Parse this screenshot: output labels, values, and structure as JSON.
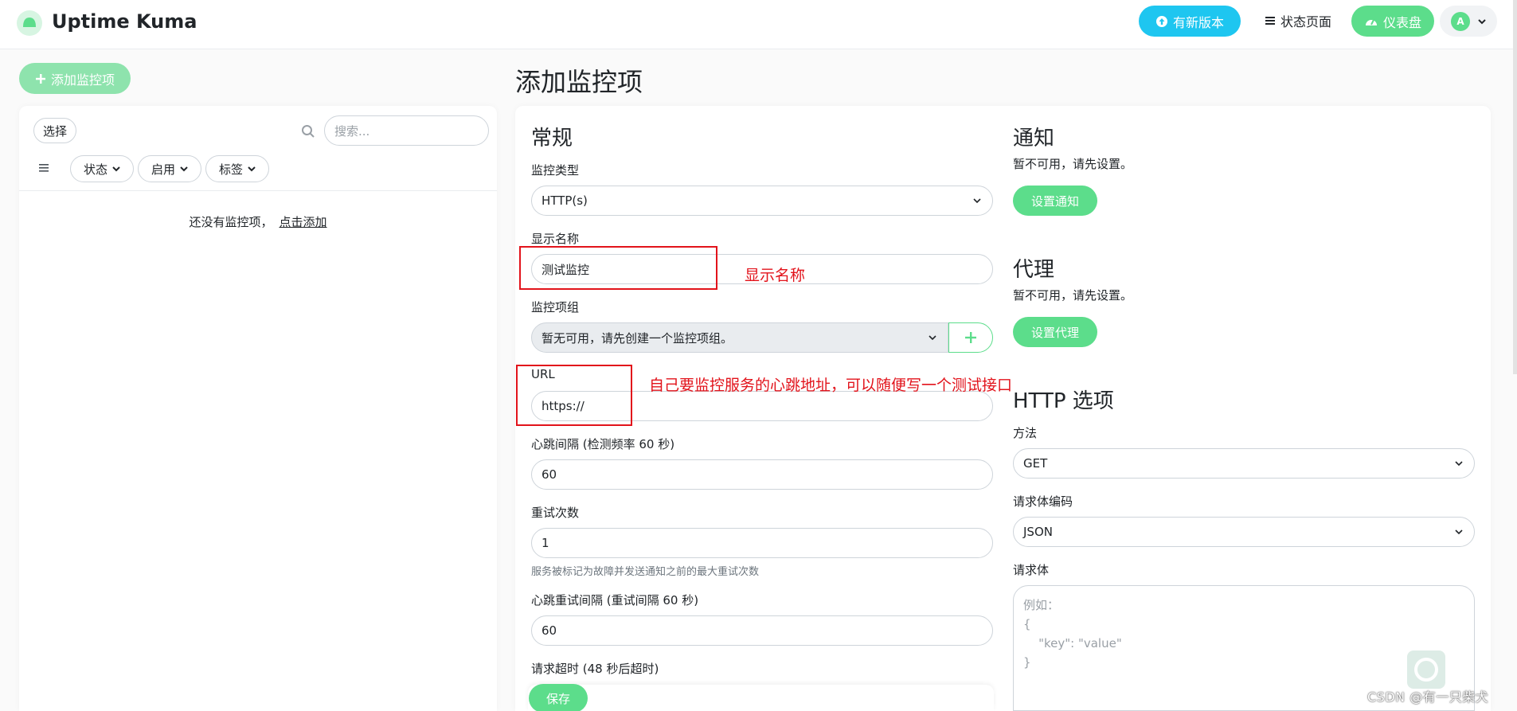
{
  "header": {
    "app_title": "Uptime Kuma",
    "update_label": "有新版本",
    "status_page_label": "状态页面",
    "dashboard_label": "仪表盘",
    "avatar_letter": "A"
  },
  "sidebar": {
    "add_button": "添加监控项",
    "select_button": "选择",
    "search_placeholder": "搜索...",
    "filters": [
      "状态",
      "启用",
      "标签"
    ],
    "empty_text": "还没有监控项，",
    "empty_link": "点击添加"
  },
  "main": {
    "page_title": "添加监控项",
    "general": {
      "title": "常规",
      "monitor_type_label": "监控类型",
      "monitor_type_value": "HTTP(s)",
      "display_name_label": "显示名称",
      "display_name_value": "测试监控",
      "group_label": "监控项组",
      "group_value": "暂无可用，请先创建一个监控项组。",
      "url_label": "URL",
      "url_value": "https://",
      "interval_label": "心跳间隔 (检测频率 60 秒)",
      "interval_value": "60",
      "retries_label": "重试次数",
      "retries_value": "1",
      "retries_help": "服务被标记为故障并发送通知之前的最大重试次数",
      "retry_interval_label": "心跳重试间隔 (重试间隔 60 秒)",
      "retry_interval_value": "60",
      "timeout_label": "请求超时 (48 秒后超时)"
    },
    "notifications": {
      "title": "通知",
      "text": "暂不可用，请先设置。",
      "button": "设置通知"
    },
    "proxy": {
      "title": "代理",
      "text": "暂不可用，请先设置。",
      "button": "设置代理"
    },
    "http_options": {
      "title": "HTTP 选项",
      "method_label": "方法",
      "method_value": "GET",
      "encoding_label": "请求体编码",
      "encoding_value": "JSON",
      "body_label": "请求体",
      "body_placeholder": "例如：\n{\n    \"key\": \"value\"\n}"
    },
    "save_button": "保存"
  },
  "annotations": {
    "display_name_note": "显示名称",
    "url_note": "自己要监控服务的心跳地址，可以随便写一个测试接口"
  },
  "watermark": "CSDN @有一只柴犬",
  "colors": {
    "primary_green": "#5cdd8b",
    "update_blue": "#1ec6f0",
    "annotation_red": "#e2131b"
  }
}
